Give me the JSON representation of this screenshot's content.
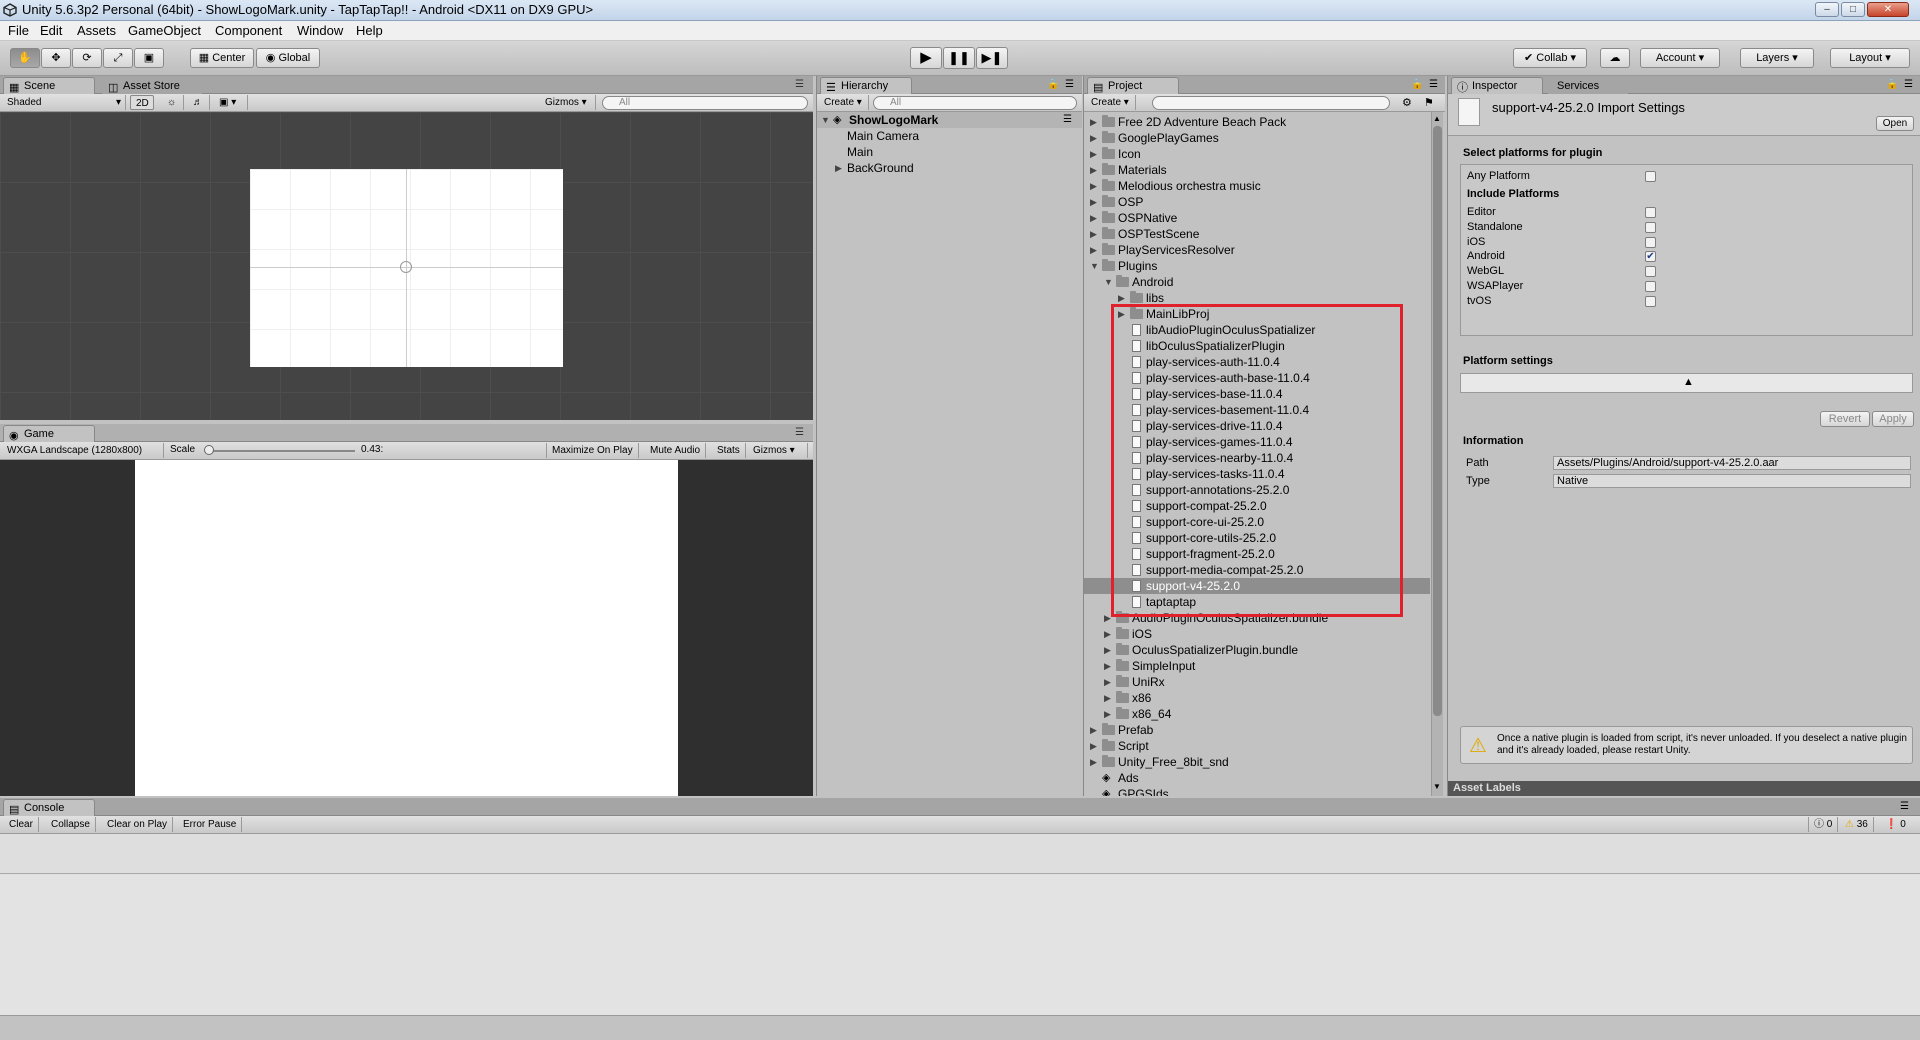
{
  "window": {
    "title": "Unity 5.6.3p2 Personal (64bit) - ShowLogoMark.unity - TapTapTap!! - Android <DX11 on DX9 GPU>"
  },
  "menu": [
    "File",
    "Edit",
    "Assets",
    "GameObject",
    "Component",
    "Window",
    "Help"
  ],
  "toolbar": {
    "pivot": "Center",
    "space": "Global",
    "collab": "Collab",
    "account": "Account",
    "layers": "Layers",
    "layout": "Layout"
  },
  "scene": {
    "tabs": [
      "Scene",
      "Asset Store"
    ],
    "shading": "Shaded",
    "mode2d": "2D",
    "gizmos": "Gizmos",
    "search_placeholder": "All"
  },
  "game": {
    "tab": "Game",
    "resolution": "WXGA Landscape (1280x800)",
    "scale_label": "Scale",
    "scale_value": "0.43:",
    "maximize": "Maximize On Play",
    "mute": "Mute Audio",
    "stats": "Stats",
    "gizmos": "Gizmos"
  },
  "hierarchy": {
    "tab": "Hierarchy",
    "create": "Create",
    "search_placeholder": "All",
    "scene_name": "ShowLogoMark",
    "items": [
      "Main Camera",
      "Main",
      "BackGround"
    ]
  },
  "project": {
    "tab": "Project",
    "create": "Create",
    "top_folders": [
      "Free 2D Adventure Beach Pack",
      "GooglePlayGames",
      "Icon",
      "Materials",
      "Melodious orchestra music",
      "OSP",
      "OSPNative",
      "OSPTestScene",
      "PlayServicesResolver",
      "Plugins"
    ],
    "plugins_android": "Android",
    "android_folders": [
      "libs",
      "MainLibProj"
    ],
    "android_files": [
      "libAudioPluginOculusSpatializer",
      "libOculusSpatializerPlugin",
      "play-services-auth-11.0.4",
      "play-services-auth-base-11.0.4",
      "play-services-base-11.0.4",
      "play-services-basement-11.0.4",
      "play-services-drive-11.0.4",
      "play-services-games-11.0.4",
      "play-services-nearby-11.0.4",
      "play-services-tasks-11.0.4",
      "support-annotations-25.2.0",
      "support-compat-25.2.0",
      "support-core-ui-25.2.0",
      "support-core-utils-25.2.0",
      "support-fragment-25.2.0",
      "support-media-compat-25.2.0",
      "support-v4-25.2.0",
      "taptaptap"
    ],
    "selected_file": "support-v4-25.2.0",
    "plugins_after": [
      "AudioPluginOculusSpatializer.bundle",
      "iOS",
      "OculusSpatializerPlugin.bundle",
      "SimpleInput",
      "UniRx",
      "x86",
      "x86_64"
    ],
    "bottom_folders": [
      "Prefab",
      "Script",
      "Unity_Free_8bit_snd"
    ],
    "bottom_items": [
      "Ads",
      "GPGSIds"
    ]
  },
  "inspector": {
    "tabs": [
      "Inspector",
      "Services"
    ],
    "title": "support-v4-25.2.0 Import Settings",
    "open": "Open",
    "select_platforms": "Select platforms for plugin",
    "any_platform": "Any Platform",
    "include_platforms": "Include Platforms",
    "platforms": [
      {
        "name": "Editor",
        "checked": false
      },
      {
        "name": "Standalone",
        "checked": false
      },
      {
        "name": "iOS",
        "checked": false
      },
      {
        "name": "Android",
        "checked": true
      },
      {
        "name": "WebGL",
        "checked": false
      },
      {
        "name": "WSAPlayer",
        "checked": false
      },
      {
        "name": "tvOS",
        "checked": false
      }
    ],
    "platform_settings": "Platform settings",
    "revert": "Revert",
    "apply": "Apply",
    "information": "Information",
    "path_label": "Path",
    "path_value": "Assets/Plugins/Android/support-v4-25.2.0.aar",
    "type_label": "Type",
    "type_value": "Native",
    "warning": "Once a native plugin is loaded from script, it's never unloaded. If you deselect a native plugin and it's already loaded, please restart Unity.",
    "asset_labels": "Asset Labels"
  },
  "console": {
    "tab": "Console",
    "buttons": [
      "Clear",
      "Collapse",
      "Clear on Play",
      "Error Pause"
    ],
    "info_count": "0",
    "warn_count": "36",
    "error_count": "0"
  },
  "colors": {
    "highlight": "#e0202a",
    "selection": "#8e8e8e",
    "accent": "#3d6fb5"
  }
}
